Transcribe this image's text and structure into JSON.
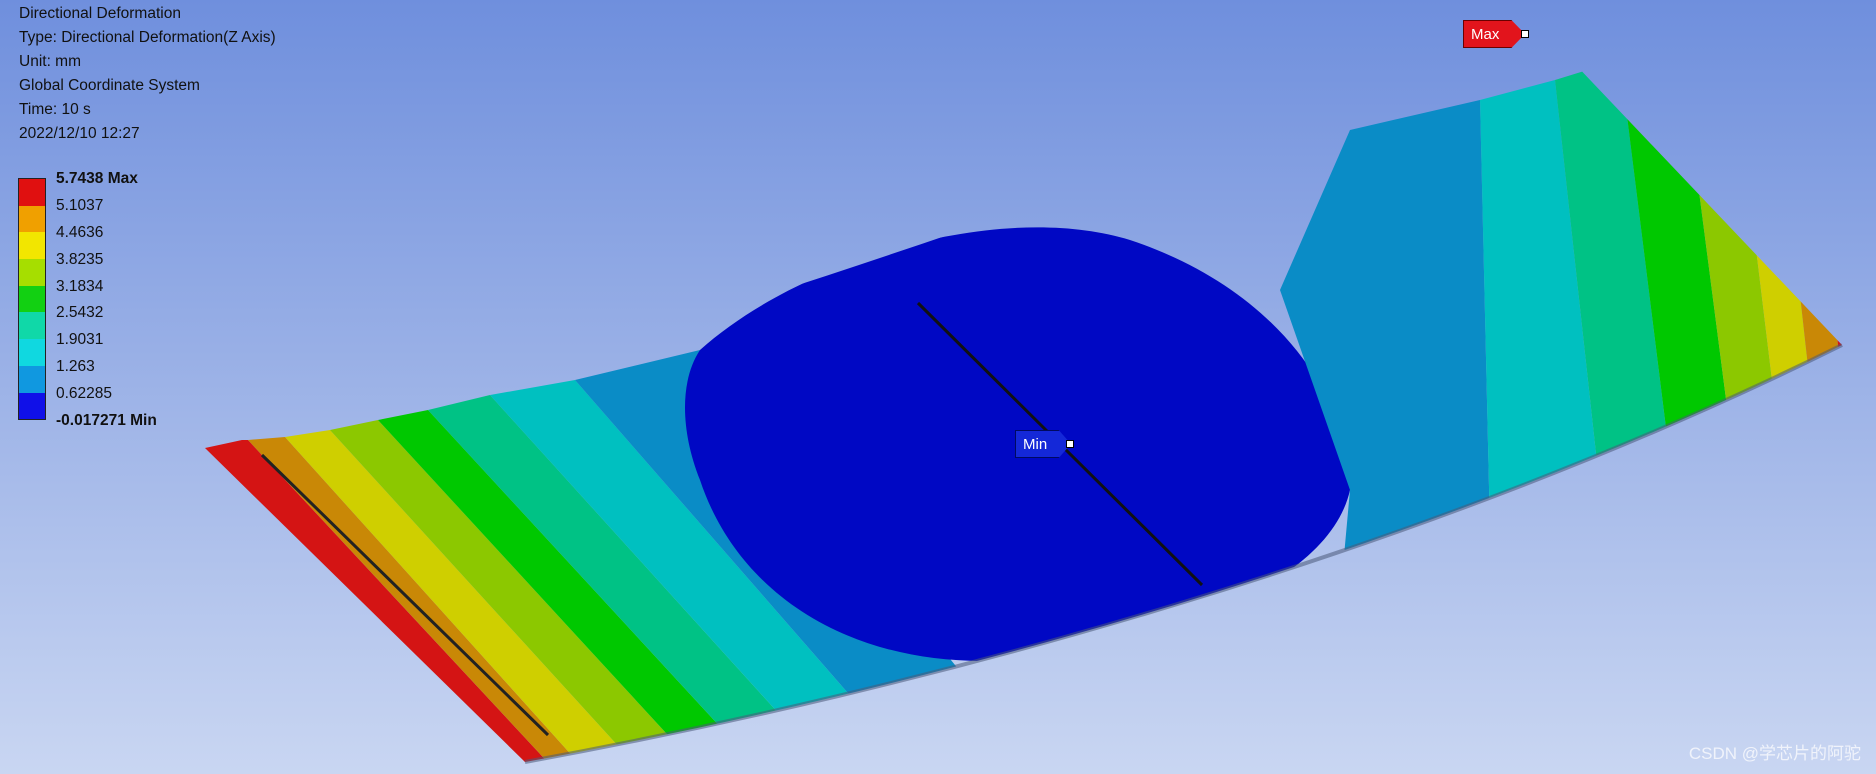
{
  "result": {
    "title": "Directional Deformation",
    "type": "Type: Directional Deformation(Z Axis)",
    "unit": "Unit: mm",
    "coordinate_system": "Global Coordinate System",
    "time": "Time: 10 s",
    "timestamp": "2022/12/10 12:27"
  },
  "legend": {
    "labels": [
      "5.7438 Max",
      "5.1037",
      "4.4636",
      "3.8235",
      "3.1834",
      "2.5432",
      "1.9031",
      "1.263",
      "0.62285",
      "-0.017271 Min"
    ],
    "colors": [
      "#e01010",
      "#f0a000",
      "#f2e600",
      "#a6de00",
      "#12d012",
      "#10d8a8",
      "#10d8e0",
      "#1098e0",
      "#1010e8"
    ]
  },
  "probes": {
    "max_label": "Max",
    "min_label": "Min"
  },
  "contour_colors": [
    "#d41414",
    "#c98806",
    "#cfcf00",
    "#8cc800",
    "#00c800",
    "#00c285",
    "#00c0c0",
    "#0a8cc6",
    "#0008c4"
  ],
  "watermark": "CSDN @学芯片的阿驼"
}
